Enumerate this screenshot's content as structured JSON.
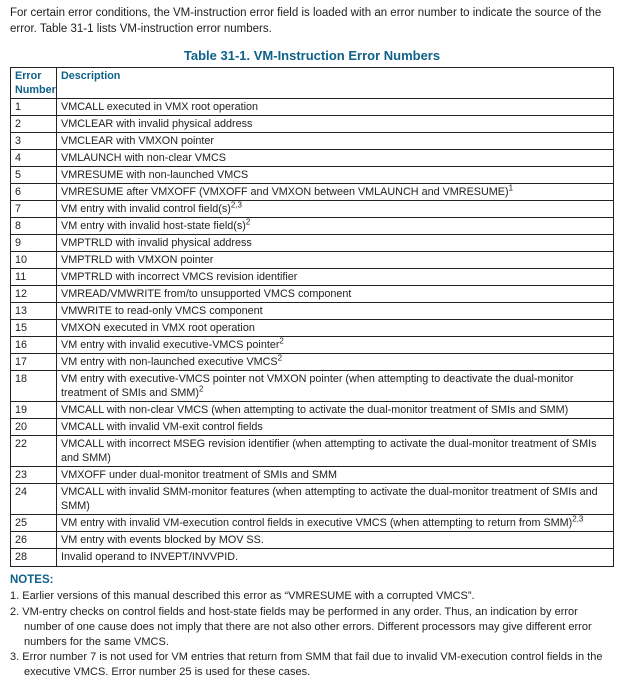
{
  "intro": "For certain error conditions, the VM-instruction error field is loaded with an error number to indicate the source of the error. Table 31-1 lists VM-instruction error numbers.",
  "table": {
    "title": "Table 31-1.  VM-Instruction Error Numbers",
    "headers": {
      "num": "Error Number",
      "desc": "Description"
    },
    "rows": [
      {
        "num": "1",
        "desc": "VMCALL executed in VMX root operation",
        "sup": ""
      },
      {
        "num": "2",
        "desc": "VMCLEAR with invalid physical address",
        "sup": ""
      },
      {
        "num": "3",
        "desc": "VMCLEAR with VMXON pointer",
        "sup": ""
      },
      {
        "num": "4",
        "desc": "VMLAUNCH with non-clear VMCS",
        "sup": ""
      },
      {
        "num": "5",
        "desc": "VMRESUME with non-launched VMCS",
        "sup": ""
      },
      {
        "num": "6",
        "desc": "VMRESUME after VMXOFF (VMXOFF and VMXON between VMLAUNCH and VMRESUME)",
        "sup": "1"
      },
      {
        "num": "7",
        "desc": "VM entry with invalid control field(s)",
        "sup": "2,3"
      },
      {
        "num": "8",
        "desc": "VM entry with invalid host-state field(s)",
        "sup": "2"
      },
      {
        "num": "9",
        "desc": "VMPTRLD with invalid physical address",
        "sup": ""
      },
      {
        "num": "10",
        "desc": "VMPTRLD with VMXON pointer",
        "sup": ""
      },
      {
        "num": "11",
        "desc": "VMPTRLD with incorrect VMCS revision identifier",
        "sup": ""
      },
      {
        "num": "12",
        "desc": "VMREAD/VMWRITE from/to unsupported VMCS component",
        "sup": ""
      },
      {
        "num": "13",
        "desc": "VMWRITE to read-only VMCS component",
        "sup": ""
      },
      {
        "num": "15",
        "desc": "VMXON executed in VMX root operation",
        "sup": ""
      },
      {
        "num": "16",
        "desc": "VM entry with invalid executive-VMCS pointer",
        "sup": "2"
      },
      {
        "num": "17",
        "desc": "VM entry with non-launched executive VMCS",
        "sup": "2"
      },
      {
        "num": "18",
        "desc": "VM entry with executive-VMCS pointer not VMXON pointer (when attempting to deactivate the dual-monitor treatment of SMIs and SMM)",
        "sup": "2"
      },
      {
        "num": "19",
        "desc": "VMCALL with non-clear VMCS (when attempting to activate the dual-monitor treatment of SMIs and SMM)",
        "sup": ""
      },
      {
        "num": "20",
        "desc": "VMCALL with invalid VM-exit control fields",
        "sup": ""
      },
      {
        "num": "22",
        "desc": "VMCALL with incorrect MSEG revision identifier (when attempting to activate the dual-monitor treatment of SMIs and SMM)",
        "sup": ""
      },
      {
        "num": "23",
        "desc": "VMXOFF under dual-monitor treatment of SMIs and SMM",
        "sup": ""
      },
      {
        "num": "24",
        "desc": "VMCALL with invalid SMM-monitor features (when attempting to activate the dual-monitor treatment of SMIs and SMM)",
        "sup": ""
      },
      {
        "num": "25",
        "desc": "VM entry with invalid VM-execution control fields in executive VMCS (when attempting to return from SMM)",
        "sup": "2,3"
      },
      {
        "num": "26",
        "desc": "VM entry with events blocked by MOV SS.",
        "sup": ""
      },
      {
        "num": "28",
        "desc": "Invalid operand to INVEPT/INVVPID.",
        "sup": ""
      }
    ]
  },
  "notes": {
    "heading": "NOTES:",
    "items": [
      "1. Earlier versions of this manual described this error as “VMRESUME with a corrupted VMCS”.",
      "2. VM-entry checks on control fields and host-state fields may be performed in any order. Thus, an indication by error number of one cause does not imply that there are not also other errors. Different processors may give different error numbers for the same VMCS.",
      "3. Error number 7 is not used for VM entries that return from SMM that fail due to invalid VM-execution control fields in the executive VMCS. Error number 25 is used for these cases."
    ]
  }
}
